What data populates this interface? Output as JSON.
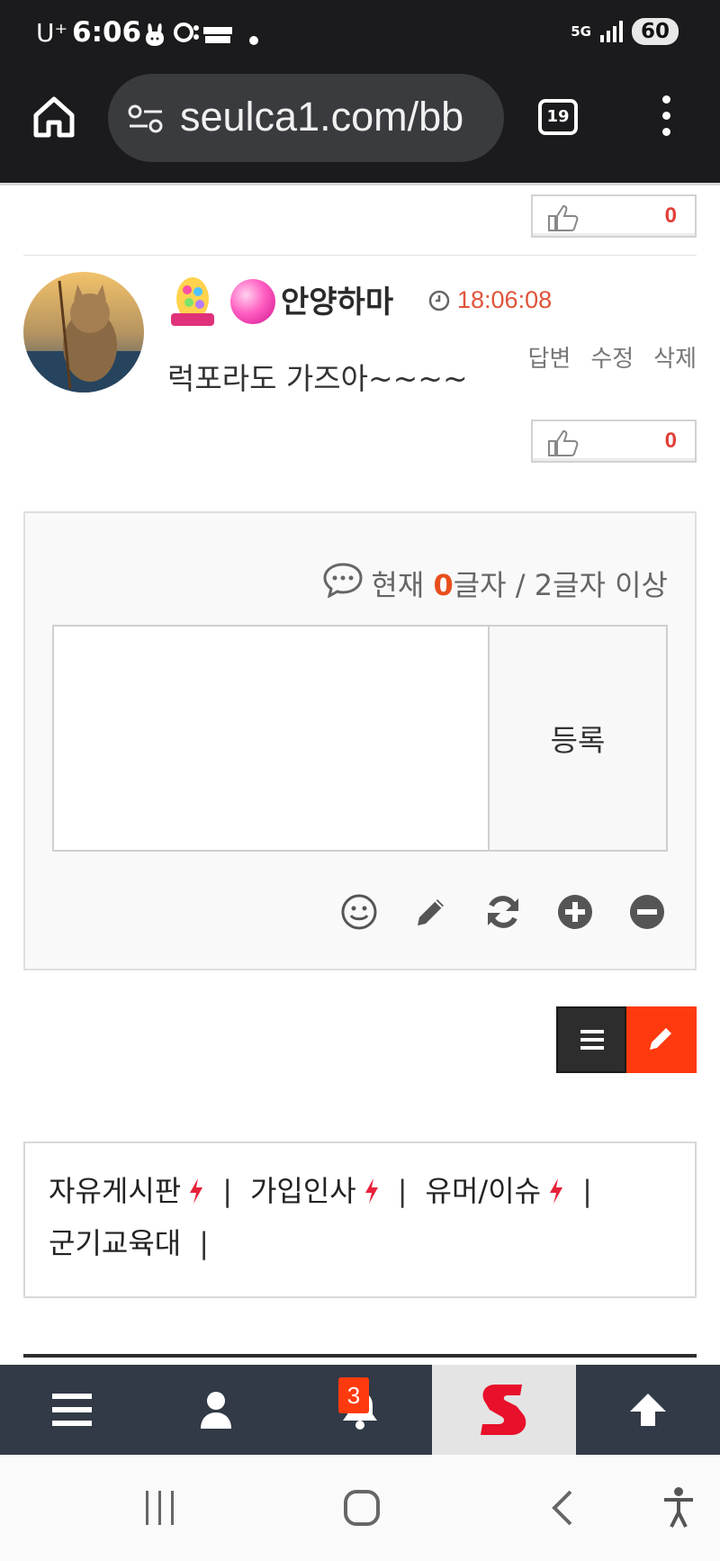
{
  "status_bar": {
    "carrier": "U⁺",
    "time": "6:06",
    "network": "5G",
    "battery": "60"
  },
  "browser": {
    "url": "seulca1.com/bb",
    "tab_count": "19"
  },
  "comments": [
    {
      "likes": "0"
    },
    {
      "nickname": "안양하마",
      "time": "18:06:08",
      "text": "럭포라도 가즈아~~~~",
      "actions": [
        "답변",
        "수정",
        "삭제"
      ],
      "likes": "0"
    }
  ],
  "comment_form": {
    "count_prefix": "현재 ",
    "count_value": "0",
    "count_suffix": "글자 / 2글자 이상",
    "submit_label": "등록"
  },
  "boards": [
    {
      "name": "자유게시판",
      "hot": true
    },
    {
      "name": "가입인사",
      "hot": true
    },
    {
      "name": "유머/이슈",
      "hot": true
    },
    {
      "name": "군기교육대",
      "hot": false
    }
  ],
  "bottom_nav": {
    "notification_count": "3",
    "logo_letter": "S"
  },
  "colors": {
    "accent": "#ff3a0f",
    "time": "#e0533a",
    "nav_bg": "#313a46"
  }
}
